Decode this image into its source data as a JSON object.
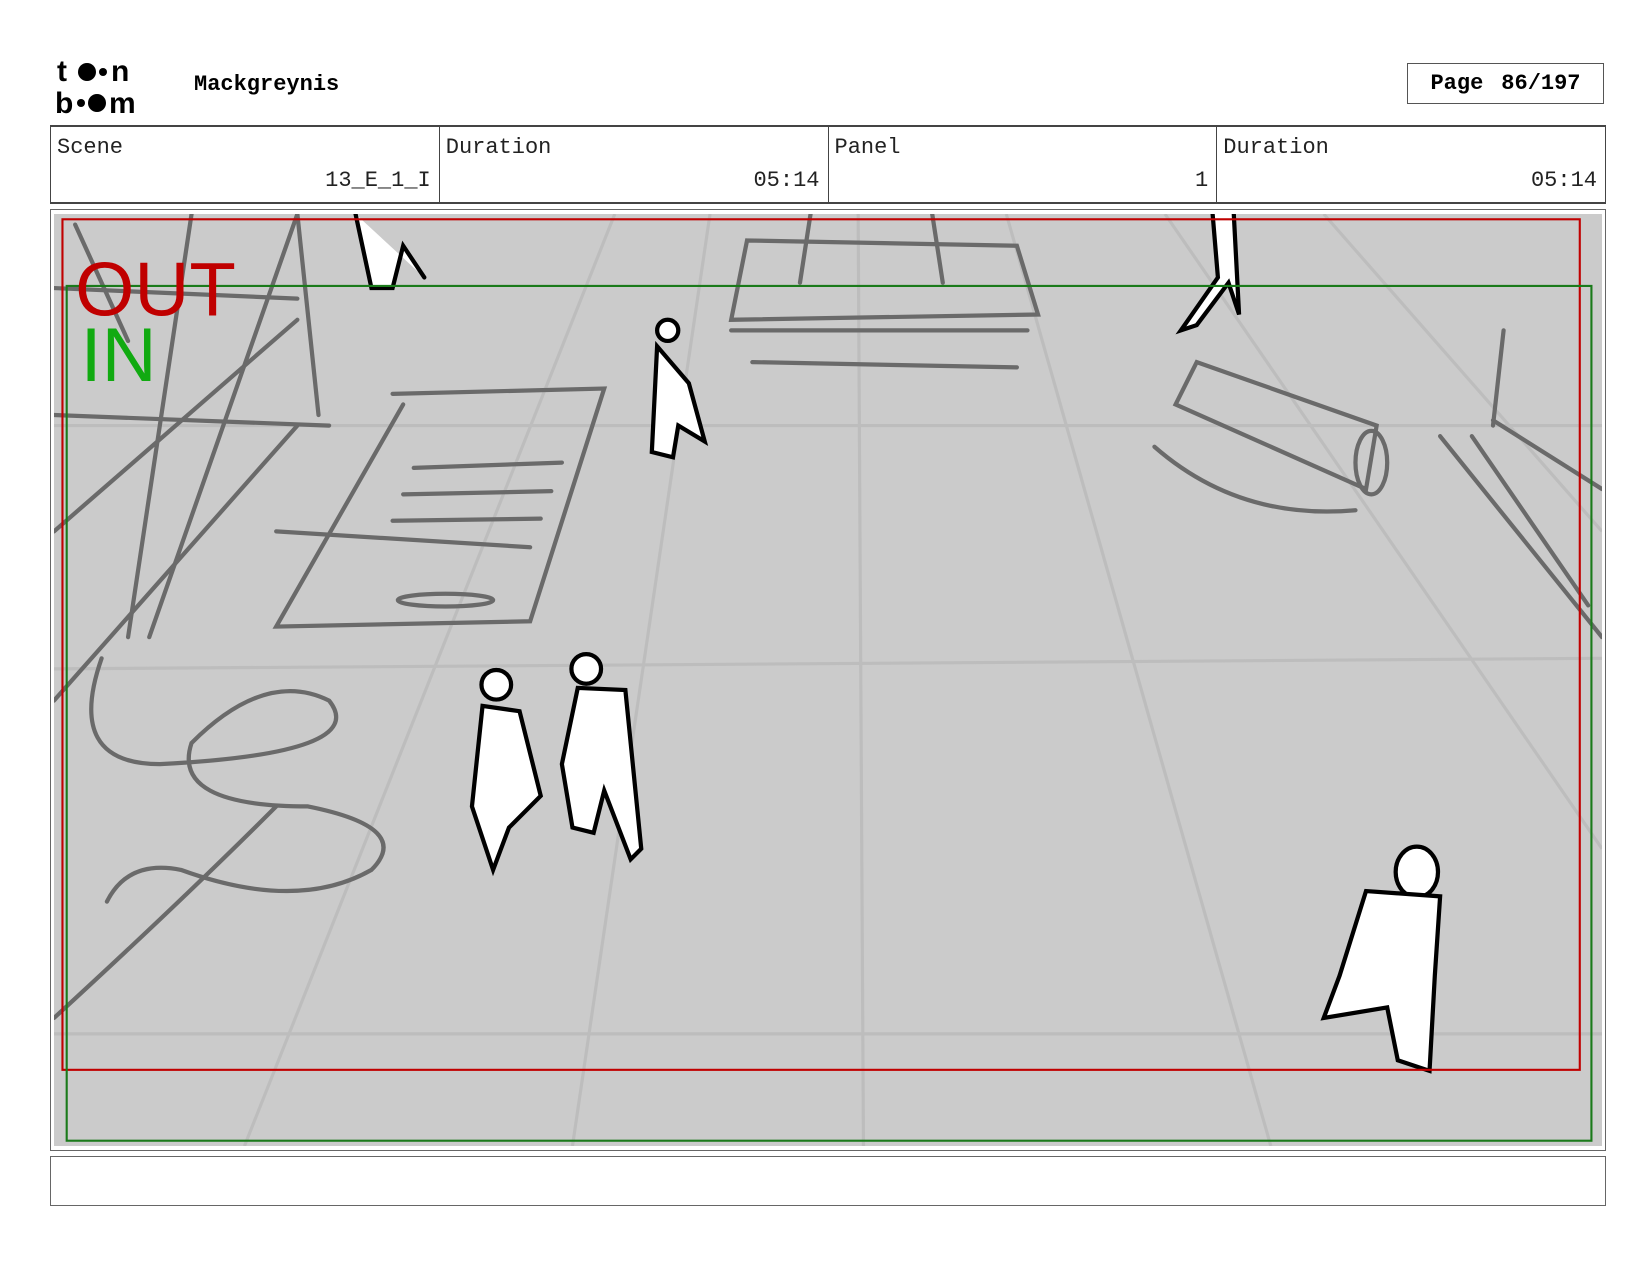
{
  "header": {
    "logo_text": "toon boom",
    "project_title": "Mackgreynis",
    "page_label": "Page",
    "page_value": "86/197"
  },
  "info": [
    {
      "label": "Scene",
      "value": "13_E_1_I"
    },
    {
      "label": "Duration",
      "value": "05:14"
    },
    {
      "label": "Panel",
      "value": "1"
    },
    {
      "label": "Duration",
      "value": "05:14"
    }
  ],
  "panel": {
    "out_label": "OUT",
    "in_label": "IN",
    "colors": {
      "out": "#c00000",
      "in": "#1a7a1a",
      "background": "#cbcbcb"
    }
  },
  "notes": {
    "text": ""
  }
}
